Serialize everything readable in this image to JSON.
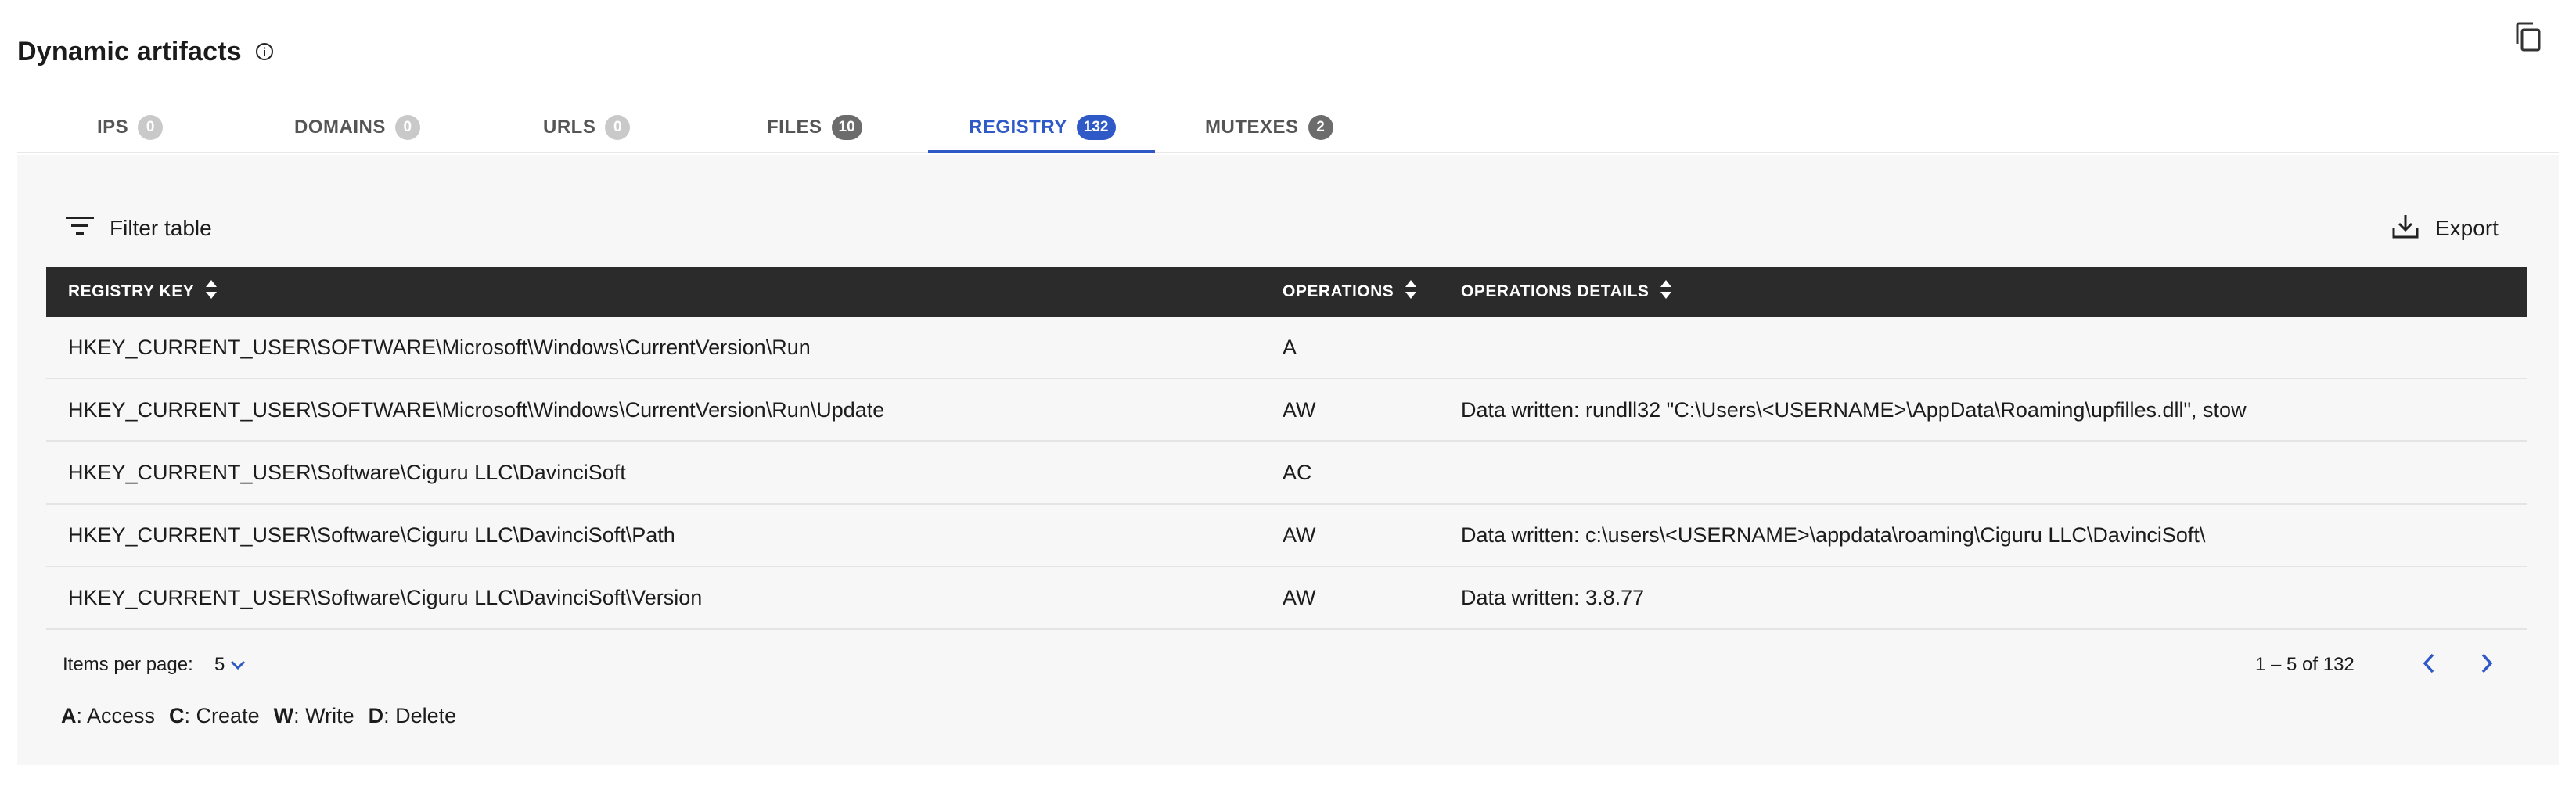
{
  "header": {
    "title": "Dynamic artifacts"
  },
  "tabs": [
    {
      "label": "IPS",
      "count": "0"
    },
    {
      "label": "DOMAINS",
      "count": "0"
    },
    {
      "label": "URLS",
      "count": "0"
    },
    {
      "label": "FILES",
      "count": "10"
    },
    {
      "label": "REGISTRY",
      "count": "132"
    },
    {
      "label": "MUTEXES",
      "count": "2"
    }
  ],
  "active_tab": "REGISTRY",
  "toolbar": {
    "filter_label": "Filter table",
    "export_label": "Export"
  },
  "table": {
    "columns": [
      "REGISTRY KEY",
      "OPERATIONS",
      "OPERATIONS DETAILS"
    ],
    "rows": [
      {
        "key": "HKEY_CURRENT_USER\\SOFTWARE\\Microsoft\\Windows\\CurrentVersion\\Run",
        "ops": "A",
        "details": ""
      },
      {
        "key": "HKEY_CURRENT_USER\\SOFTWARE\\Microsoft\\Windows\\CurrentVersion\\Run\\Update",
        "ops": "AW",
        "details": "Data written: rundll32 \"C:\\Users\\<USERNAME>\\AppData\\Roaming\\upfilles.dll\", stow"
      },
      {
        "key": "HKEY_CURRENT_USER\\Software\\Ciguru LLC\\DavinciSoft",
        "ops": "AC",
        "details": ""
      },
      {
        "key": "HKEY_CURRENT_USER\\Software\\Ciguru LLC\\DavinciSoft\\Path",
        "ops": "AW",
        "details": "Data written: c:\\users\\<USERNAME>\\appdata\\roaming\\Ciguru LLC\\DavinciSoft\\"
      },
      {
        "key": "HKEY_CURRENT_USER\\Software\\Ciguru LLC\\DavinciSoft\\Version",
        "ops": "AW",
        "details": "Data written: 3.8.77"
      }
    ]
  },
  "pagination": {
    "items_per_page_label": "Items per page:",
    "items_per_page": "5",
    "range": "1 – 5 of 132"
  },
  "legend": [
    {
      "key": "A",
      "label": ": Access"
    },
    {
      "key": "C",
      "label": ": Create"
    },
    {
      "key": "W",
      "label": ": Write"
    },
    {
      "key": "D",
      "label": ": Delete"
    }
  ],
  "colors": {
    "accent": "#2e59c7",
    "header_bg": "#2b2b2b",
    "panel_bg": "#f7f7f7"
  }
}
